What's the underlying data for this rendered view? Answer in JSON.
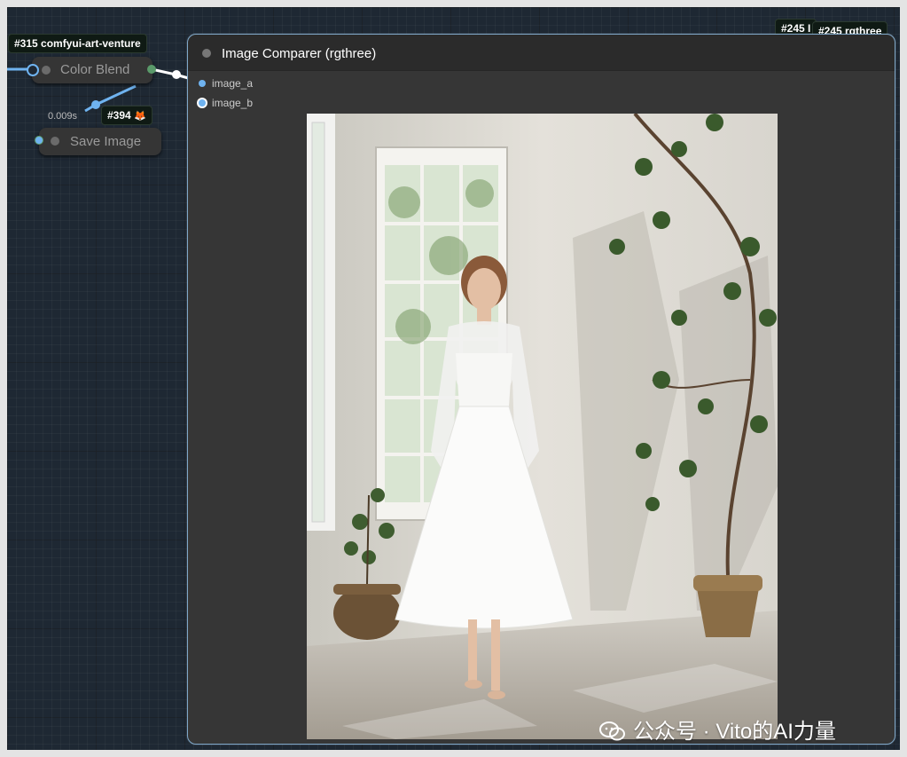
{
  "badges": {
    "node315": "#315 comfyui-art-venture",
    "node394": "#394",
    "node394_emoji": "🦊",
    "node245_short": "#245 I",
    "node245": "#245 rgthree"
  },
  "nodes": {
    "color_blend": {
      "label": "Color Blend"
    },
    "save_image": {
      "label": "Save Image",
      "timing": "0.009s"
    },
    "image_comparer": {
      "title": "Image Comparer (rgthree)",
      "inputs": [
        "image_a",
        "image_b"
      ]
    }
  },
  "watermark": "公众号 · Vito的AI力量",
  "colors": {
    "canvas_bg": "#1e2833",
    "node_bg": "#353535",
    "link_blue": "#6fb3f0",
    "link_white": "#ffffff",
    "node_border_selected": "#7fa8c9"
  },
  "icons": [
    "wechat-icon",
    "fox-icon"
  ]
}
